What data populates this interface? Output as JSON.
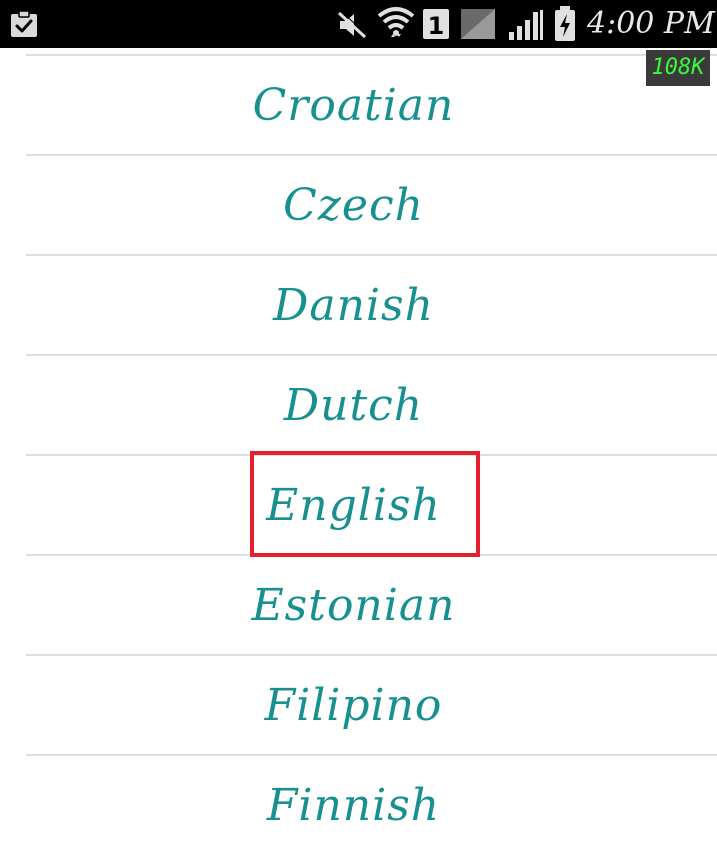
{
  "status_bar": {
    "icons": [
      "clipboard-check-icon",
      "mute-icon",
      "wifi-icon",
      "sim-1-icon",
      "no-signal-icon",
      "cell-signal-icon",
      "battery-charging-icon"
    ],
    "sim_label": "1",
    "time": "4:00 PM",
    "network_speed": "108K",
    "colors": {
      "background": "#000000",
      "icons": "#e8e8e8",
      "speed_text": "#3df53d"
    }
  },
  "language_list": {
    "items": [
      {
        "label": "Croatian"
      },
      {
        "label": "Czech"
      },
      {
        "label": "Danish"
      },
      {
        "label": "Dutch"
      },
      {
        "label": "English"
      },
      {
        "label": "Estonian"
      },
      {
        "label": "Filipino"
      },
      {
        "label": "Finnish"
      }
    ],
    "highlighted": "English",
    "colors": {
      "text": "#17908f",
      "divider": "#dedede",
      "highlight": "#e51f2b"
    }
  }
}
